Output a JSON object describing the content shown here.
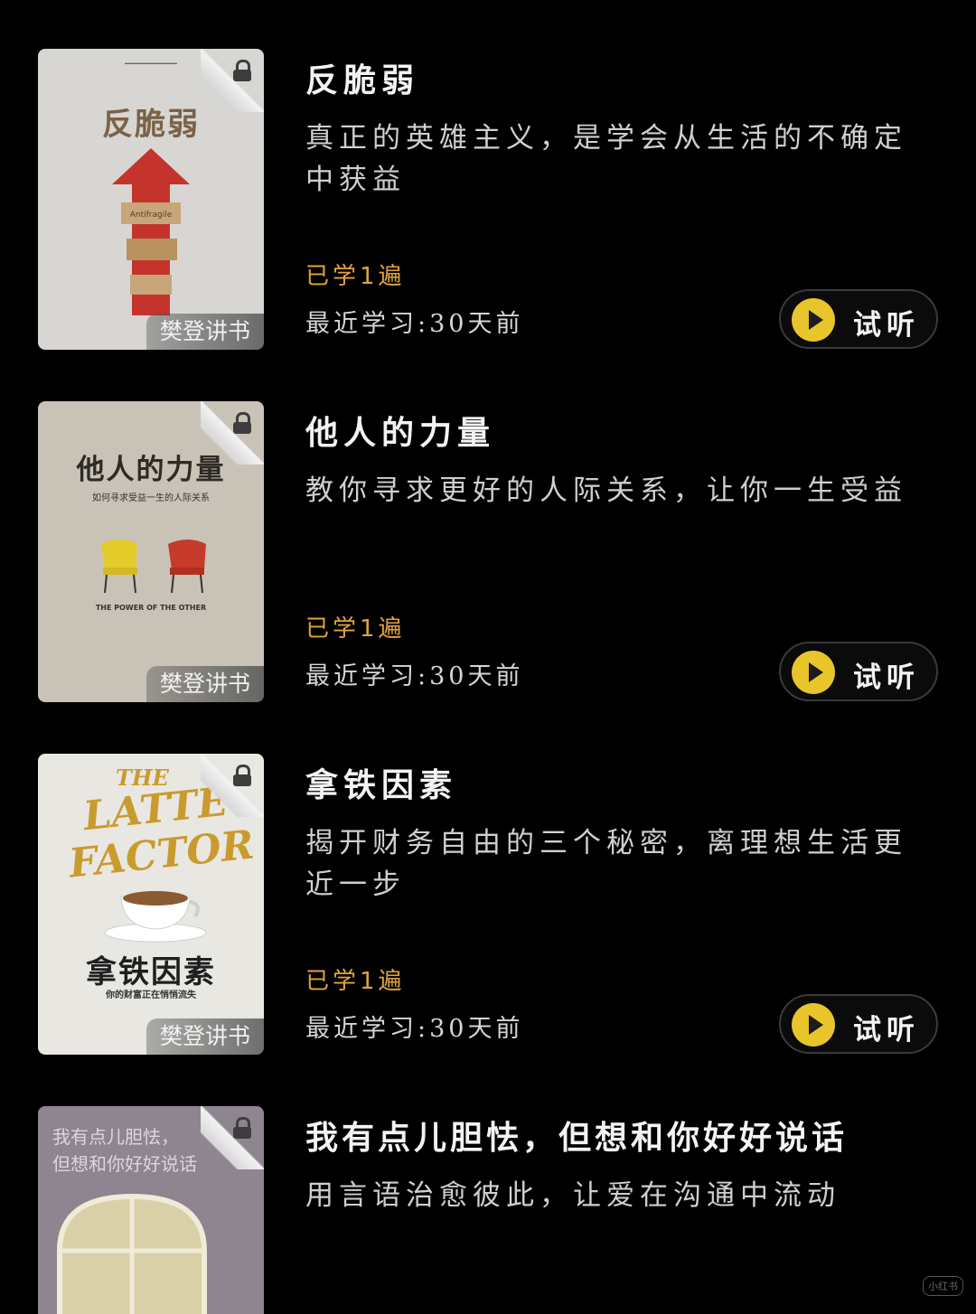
{
  "books": [
    {
      "title": "反脆弱",
      "description": "真正的英雄主义，是学会从生活的不确定中获益",
      "learned": "已学1遍",
      "recent": "最近学习:30天前",
      "listen_label": "试听",
      "publisher_badge": "樊登讲书",
      "cover": {
        "title": "反脆弱",
        "subtitle": "Antifragile",
        "bg": "#d8d6d3",
        "accent": "#c4342c"
      }
    },
    {
      "title": "他人的力量",
      "description": "教你寻求更好的人际关系，让你一生受益",
      "learned": "已学1遍",
      "recent": "最近学习:30天前",
      "listen_label": "试听",
      "publisher_badge": "樊登讲书",
      "cover": {
        "title": "他人的力量",
        "subtitle": "如何寻求受益一生的人际关系",
        "caption": "THE POWER OF THE OTHER",
        "bg": "#c8c3b6",
        "accent": "#c63a2a"
      }
    },
    {
      "title": "拿铁因素",
      "description": "揭开财务自由的三个秘密，离理想生活更近一步",
      "learned": "已学1遍",
      "recent": "最近学习:30天前",
      "listen_label": "试听",
      "publisher_badge": "樊登讲书",
      "cover": {
        "title": "拿铁因素",
        "en_title_1": "THE",
        "en_title_2": "LATTE",
        "en_title_3": "FACTOR",
        "subtitle": "你的财富正在悄悄流失",
        "bg": "#e9e7e2",
        "accent": "#c99b2e"
      }
    },
    {
      "title": "我有点儿胆怯，但想和你好好说话",
      "description": "用言语治愈彼此，让爱在沟通中流动",
      "cover": {
        "title_line1": "我有点儿胆怯，",
        "title_line2": "但想和你好好说话",
        "bg": "#8e8590"
      }
    }
  ],
  "watermark": "小红书"
}
